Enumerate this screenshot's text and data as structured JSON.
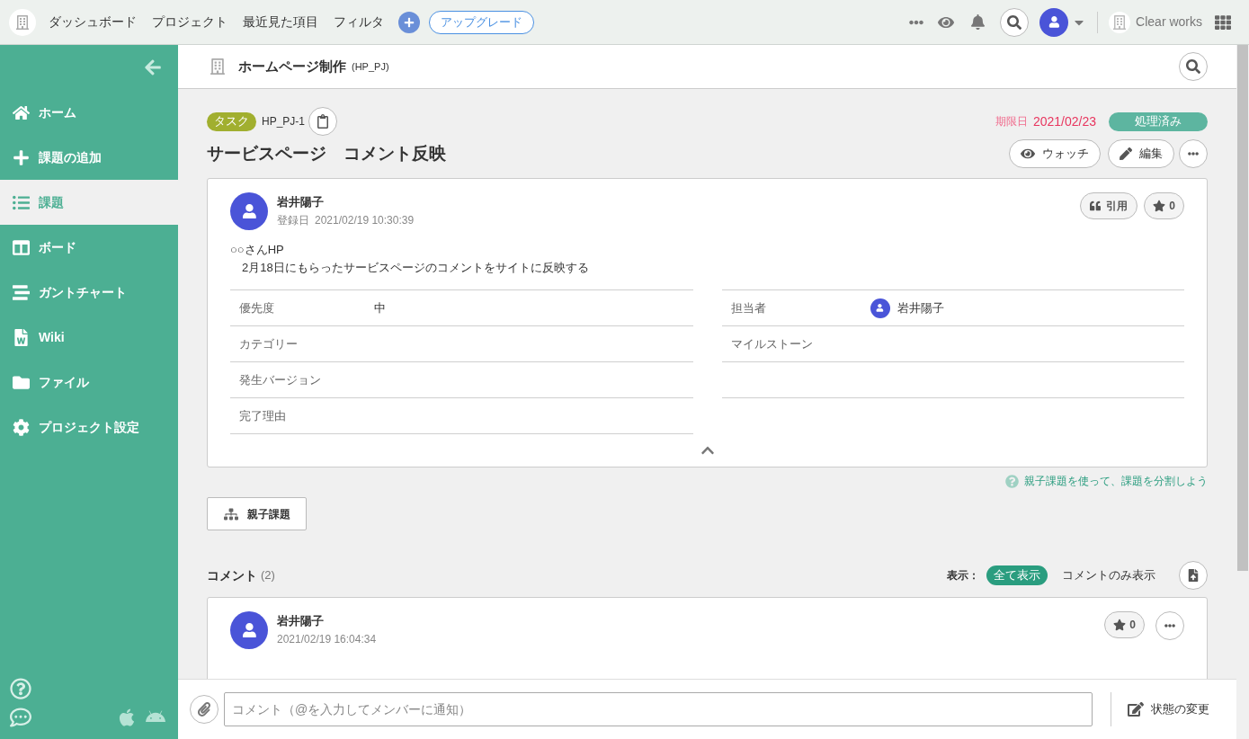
{
  "top_nav": {
    "menu": [
      "ダッシュボード",
      "プロジェクト",
      "最近見た項目",
      "フィルタ"
    ],
    "upgrade": "アップグレード",
    "space": "Clear works"
  },
  "sidebar": {
    "items": [
      {
        "label": "ホーム",
        "selected": false
      },
      {
        "label": "課題の追加",
        "selected": false
      },
      {
        "label": "課題",
        "selected": true
      },
      {
        "label": "ボード",
        "selected": false
      },
      {
        "label": "ガントチャート",
        "selected": false
      },
      {
        "label": "Wiki",
        "selected": false
      },
      {
        "label": "ファイル",
        "selected": false
      },
      {
        "label": "プロジェクト設定",
        "selected": false
      }
    ]
  },
  "project": {
    "name": "ホームページ制作",
    "key": "(HP_PJ)"
  },
  "issue": {
    "type": "タスク",
    "key": "HP_PJ-1",
    "due_label": "期限日",
    "due_date": "2021/02/23",
    "status": "処理済み",
    "title": "サービスページ　コメント反映",
    "watch": "ウォッチ",
    "edit": "編集",
    "author": "岩井陽子",
    "created_label": "登録日",
    "created": "2021/02/19 10:30:39",
    "quote": "引用",
    "star_count": "0",
    "description": [
      "○○さんHP",
      "　2月18日にもらったサービスページのコメントをサイトに反映する"
    ],
    "fields_left": [
      {
        "label": "優先度",
        "value": "中"
      },
      {
        "label": "カテゴリー"
      },
      {
        "label": "発生バージョン"
      },
      {
        "label": "完了理由"
      }
    ],
    "fields_right": [
      {
        "label": "担当者",
        "value": "岩井陽子"
      },
      {
        "label": "マイルストーン"
      }
    ],
    "expanded": true
  },
  "hint": "親子課題を使って、課題を分割しよう",
  "subtask_button": "親子課題",
  "comments": {
    "title": "コメント",
    "count": "(2)",
    "view_label": "表示：",
    "filters": [
      {
        "label": "全て表示",
        "selected": true
      },
      {
        "label": "コメントのみ表示",
        "selected": false
      }
    ],
    "items": [
      {
        "author": "岩井陽子",
        "date": "2021/02/19 16:04:34",
        "star_count": "0"
      }
    ]
  },
  "composer": {
    "placeholder": "コメント（@を入力してメンバーに通知）",
    "status_button": "状態の変更"
  }
}
